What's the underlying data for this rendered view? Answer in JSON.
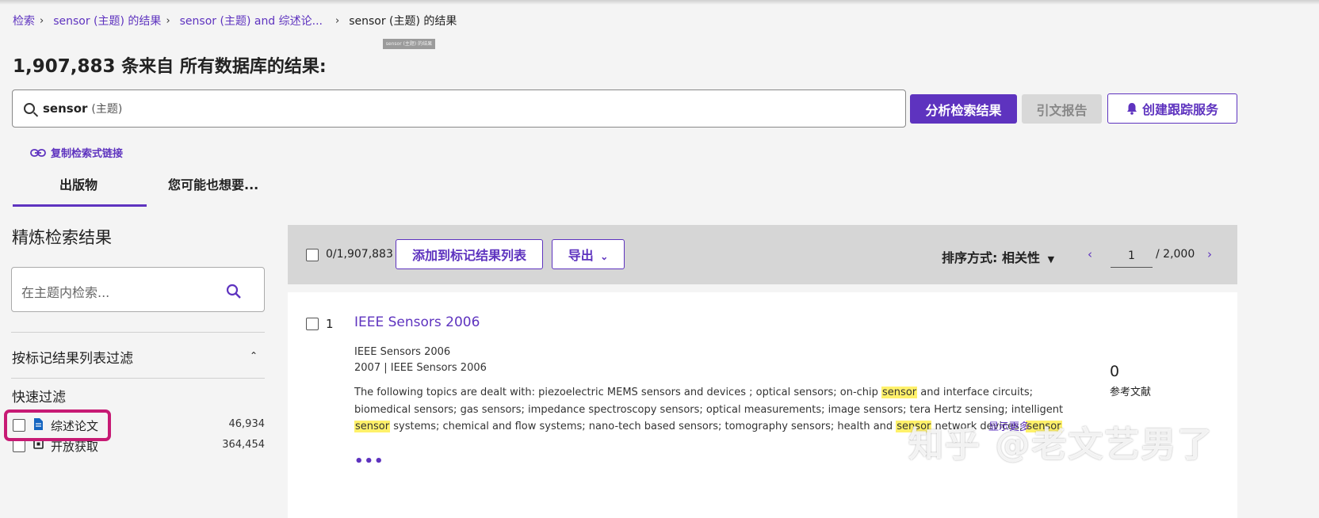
{
  "breadcrumb": {
    "items": [
      {
        "label": "检索"
      },
      {
        "label": "sensor (主题) 的结果"
      },
      {
        "label": "sensor (主题) and 综述论..."
      }
    ],
    "current": "sensor (主题) 的结果"
  },
  "tooltip": "sensor (主题) 的结果",
  "results_header": {
    "count": "1,907,883",
    "suffix": " 条来自 所有数据库的结果:"
  },
  "search": {
    "term": "sensor",
    "field": "(主题)"
  },
  "actions": {
    "analyze": "分析检索结果",
    "citation_report": "引文报告",
    "create_alert": "创建跟踪服务"
  },
  "copy_link": "复制检索式链接",
  "tabs": [
    {
      "label": "出版物",
      "active": true
    },
    {
      "label": "您可能也想要..."
    }
  ],
  "sidebar": {
    "title": "精炼检索结果",
    "search_placeholder": "在主题内检索...",
    "filter_marked": "按标记结果列表过滤",
    "quick_filters_title": "快速过滤",
    "quick_filters": [
      {
        "label": "综述论文",
        "count": "46,934",
        "icon": "document-icon"
      },
      {
        "label": "开放获取",
        "count": "364,454",
        "icon": "open-access-icon"
      }
    ]
  },
  "results_bar": {
    "selected": "0/1,907,883",
    "add_to_marked": "添加到标记结果列表",
    "export": "导出",
    "sort_label": "排序方式: 相关性",
    "page_current": "1",
    "page_total": "/ 2,000"
  },
  "results": [
    {
      "index": "1",
      "title": "IEEE Sensors 2006",
      "source": "IEEE Sensors 2006",
      "year_source": "2007 | IEEE Sensors 2006",
      "abstract_parts": [
        "The following topics are dealt with: piezoelectric MEMS sensors and devices ; optical sensors; on-chip ",
        "sensor",
        " and interface circuits; biomedical sensors; gas sensors; impedance spectroscopy sensors; optical measurements; image sensors; tera Hertz sensing; intelligent ",
        "sensor",
        " systems; chemical and flow systems; nano-tech based sensors; tomography sensors; health and ",
        "sensor",
        " network devices; ",
        "sensor"
      ],
      "more": "•••",
      "show_more": "显示更多",
      "refs_count": "0",
      "refs_label": "参考文献"
    }
  ],
  "watermark": "知乎 @老文艺男了",
  "colors": {
    "accent": "#5e33bf",
    "highlight": "#fff16a",
    "annotation": "#c71a74"
  }
}
